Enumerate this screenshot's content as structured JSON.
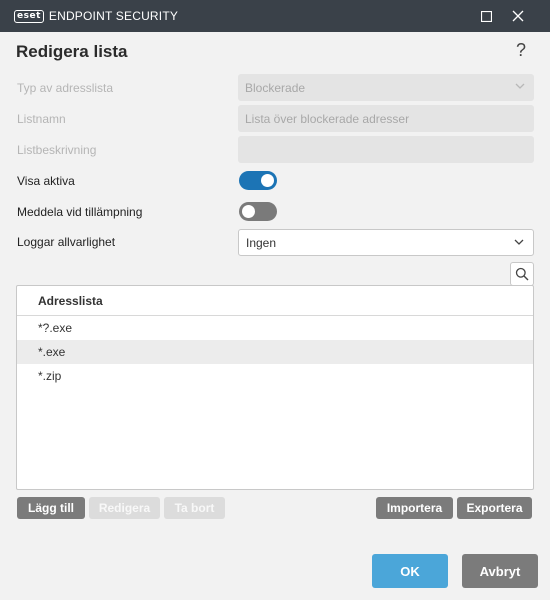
{
  "window": {
    "logo_mark": "eset",
    "product_name": "ENDPOINT SECURITY",
    "maximize_icon": "maximize-icon",
    "close_icon": "close-icon"
  },
  "dialog": {
    "title": "Redigera lista",
    "help_label": "?"
  },
  "form": {
    "list_type": {
      "label": "Typ av adresslista",
      "value": "Blockerade"
    },
    "list_name": {
      "label": "Listnamn",
      "value": "Lista över blockerade adresser"
    },
    "list_description": {
      "label": "Listbeskrivning",
      "value": ""
    },
    "show_active": {
      "label": "Visa aktiva",
      "on": true
    },
    "notify_on_apply": {
      "label": "Meddela vid tillämpning",
      "on": false
    },
    "log_severity": {
      "label": "Loggar allvarlighet",
      "value": "Ingen"
    }
  },
  "address_list": {
    "header": "Adresslista",
    "rows": [
      "*?.exe",
      "*.exe",
      "*.zip"
    ],
    "selected_index": 1
  },
  "list_actions": {
    "add": "Lägg till",
    "edit": "Redigera",
    "delete": "Ta bort",
    "import": "Importera",
    "export": "Exportera"
  },
  "footer": {
    "ok": "OK",
    "cancel": "Avbryt"
  },
  "colors": {
    "titlebar": "#3a4149",
    "toggle_on": "#1c74b5",
    "toggle_off": "#7a7a7a",
    "ok_button": "#4ba6d9",
    "secondary_button": "#7b7b7b"
  }
}
